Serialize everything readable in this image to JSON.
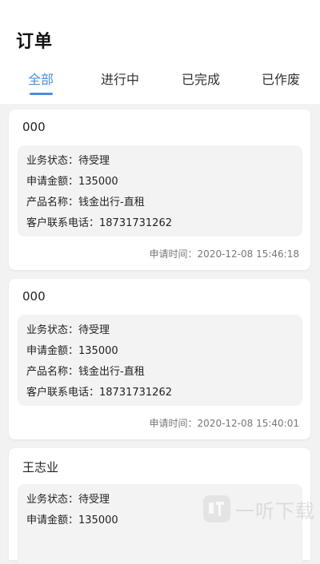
{
  "header": {
    "title": "订单"
  },
  "tabs": [
    {
      "label": "全部",
      "active": true
    },
    {
      "label": "进行中",
      "active": false
    },
    {
      "label": "已完成",
      "active": false
    },
    {
      "label": "已作废",
      "active": false
    }
  ],
  "orders": [
    {
      "name": "000",
      "status": "业务状态：待受理",
      "amount": "申请金额：135000",
      "product": "产品名称：钱金出行-直租",
      "phone": "客户联系电话：18731731262",
      "time": "申请时间：2020-12-08 15:46:18"
    },
    {
      "name": "000",
      "status": "业务状态：待受理",
      "amount": "申请金额：135000",
      "product": "产品名称：钱金出行-直租",
      "phone": "客户联系电话：18731731262",
      "time": "申请时间：2020-12-08 15:40:01"
    },
    {
      "name": "王志业",
      "status": "业务状态：待受理",
      "amount": "申请金额：135000"
    }
  ],
  "watermark": {
    "logo_char": "听",
    "text": "一听下载"
  },
  "colors": {
    "accent": "#4a90d9",
    "background": "#f2f2f2",
    "card": "#ffffff",
    "detail_bg": "#f3f3f3"
  }
}
